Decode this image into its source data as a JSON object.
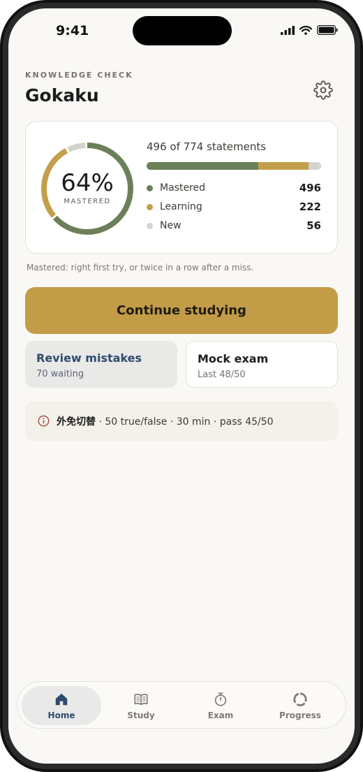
{
  "status": {
    "time": "9:41"
  },
  "header": {
    "eyebrow": "KNOWLEDGE CHECK",
    "title": "Gokaku"
  },
  "progress": {
    "percent_label": "64%",
    "percent_caption": "MASTERED",
    "percent_value": 0.64,
    "summary": "496 of 774 statements",
    "total": 774,
    "rows": [
      {
        "label": "Mastered",
        "value": "496",
        "count": 496,
        "color": "#6b8059"
      },
      {
        "label": "Learning",
        "value": "222",
        "count": 222,
        "color": "#c39f4b"
      },
      {
        "label": "New",
        "value": "56",
        "count": 56,
        "color": "#d6d3ce"
      }
    ]
  },
  "note": "Mastered: right first try, or twice in a row after a miss.",
  "actions": {
    "continue_label": "Continue studying",
    "review": {
      "title": "Review mistakes",
      "sub": "70 waiting"
    },
    "mock": {
      "title": "Mock exam",
      "sub": "Last 48/50"
    }
  },
  "info": {
    "exam_name": "外免切替",
    "details": " · 50 true/false · 30 min · pass 45/50",
    "icon": "info-icon"
  },
  "tabs": [
    {
      "label": "Home",
      "icon": "home-icon",
      "active": true
    },
    {
      "label": "Study",
      "icon": "book-icon",
      "active": false
    },
    {
      "label": "Exam",
      "icon": "stopwatch-icon",
      "active": false
    },
    {
      "label": "Progress",
      "icon": "progress-ring-icon",
      "active": false
    }
  ],
  "colors": {
    "accent": "#c29c47",
    "mastered": "#6b8059",
    "learning": "#c39f4b",
    "new": "#d6d3ce",
    "nav_active": "#2f4b6e"
  }
}
